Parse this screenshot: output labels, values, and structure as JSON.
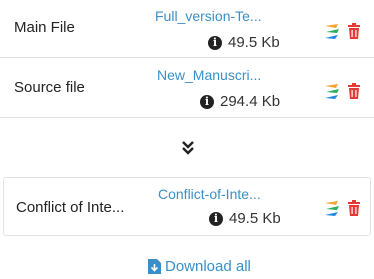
{
  "files": [
    {
      "label": "Main File",
      "filename": "Full_version-Te...",
      "size": "49.5 Kb"
    },
    {
      "label": "Source file",
      "filename": "New_Manuscri...",
      "size": "294.4 Kb"
    },
    {
      "label": "Conflict of Inte...",
      "filename": "Conflict-of-Inte...",
      "size": "49.5 Kb"
    }
  ],
  "download_all_label": "Download all",
  "icons": {
    "info": "info-circle-icon",
    "edit": "edit-annotate-icon",
    "delete": "trash-icon",
    "expand": "double-chevron-down-icon",
    "download": "file-download-icon"
  },
  "colors": {
    "link": "#3a8fc7",
    "delete": "#e53935",
    "edit_orange": "#f2a531",
    "edit_green": "#27ae60",
    "edit_blue": "#1e88e5"
  }
}
